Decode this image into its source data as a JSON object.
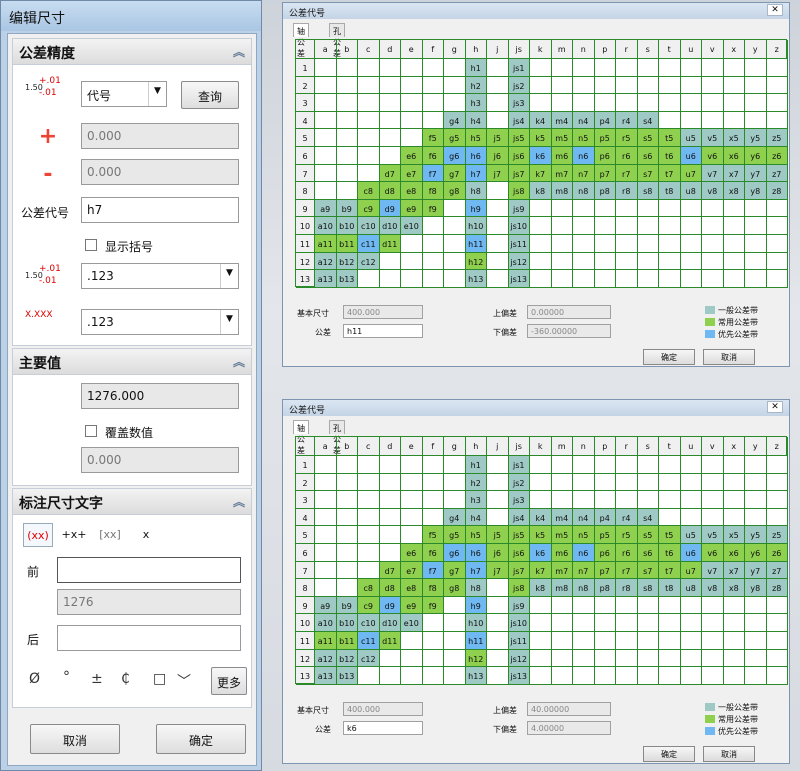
{
  "colors": {
    "general": "#9ec9c4",
    "common": "#8fd14f",
    "preferred": "#6fb8f2"
  },
  "editor": {
    "title": "编辑尺寸",
    "tolerance_precision": {
      "header": "公差精度",
      "tol_type": "代号",
      "query_button": "查询",
      "plus_value": "0.000",
      "minus_value": "0.000",
      "code_label": "公差代号",
      "code_value": "h7",
      "show_parens": "显示括号",
      "precision1": ".123",
      "precision2": ".123",
      "icon_upper": "+.01",
      "icon_lower": "-.01",
      "icon_base": "1.50"
    },
    "main_value": {
      "header": "主要值",
      "value": "1276.000",
      "override_label": "覆盖数值",
      "override_value": "0.000"
    },
    "dim_text": {
      "header": "标注尺寸文字",
      "modes": [
        "(xx)",
        "+x+",
        "[xx]",
        "x"
      ],
      "prefix_label": "前",
      "prefix_value": "",
      "mid_value": "1276",
      "suffix_label": "后",
      "suffix_value": "",
      "symbols": [
        "Ø",
        "°",
        "±",
        "₵",
        "□",
        "﹀"
      ],
      "more_button": "更多"
    },
    "cancel_button": "取消",
    "ok_button": "确定"
  },
  "tol_dialog_common": {
    "title": "公差代号",
    "tabs": [
      "轴公差",
      "孔公差"
    ],
    "columns": [
      "a",
      "b",
      "c",
      "d",
      "e",
      "f",
      "g",
      "h",
      "j",
      "js",
      "k",
      "m",
      "n",
      "p",
      "r",
      "s",
      "t",
      "u",
      "v",
      "x",
      "y",
      "z"
    ],
    "rows": [
      "1",
      "2",
      "3",
      "4",
      "5",
      "6",
      "7",
      "8",
      "9",
      "10",
      "11",
      "12",
      "13"
    ],
    "basic_size_label": "基本尺寸",
    "tol_label": "公差",
    "upper_label": "上偏差",
    "lower_label": "下偏差",
    "legend": [
      "一般公差带",
      "常用公差带",
      "优先公差带"
    ],
    "ok_button": "确定",
    "cancel_button": "取消",
    "cells": {
      "1": {
        "h": "h1",
        "js": "js1"
      },
      "2": {
        "h": "h2",
        "js": "js2"
      },
      "3": {
        "h": "h3",
        "js": "js3"
      },
      "4": {
        "g": "g4",
        "h": "h4",
        "js": "js4",
        "k": "k4",
        "m": "m4",
        "n": "n4",
        "p": "p4",
        "r": "r4",
        "s": "s4"
      },
      "5": {
        "f": "f5",
        "g": "g5",
        "h": "h5",
        "j": "j5",
        "js": "js5",
        "k": "k5",
        "m": "m5",
        "n": "n5",
        "p": "p5",
        "r": "r5",
        "s": "s5",
        "t": "t5",
        "u": "u5",
        "v": "v5",
        "x": "x5",
        "y": "y5",
        "z": "z5"
      },
      "6": {
        "e": "e6",
        "f": "f6",
        "g": "g6",
        "h": "h6",
        "j": "j6",
        "js": "js6",
        "k": "k6",
        "m": "m6",
        "n": "n6",
        "p": "p6",
        "r": "r6",
        "s": "s6",
        "t": "t6",
        "u": "u6",
        "v": "v6",
        "x": "x6",
        "y": "y6",
        "z": "z6"
      },
      "7": {
        "d": "d7",
        "e": "e7",
        "f": "f7",
        "g": "g7",
        "h": "h7",
        "j": "j7",
        "js": "js7",
        "k": "k7",
        "m": "m7",
        "n": "n7",
        "p": "p7",
        "r": "r7",
        "s": "s7",
        "t": "t7",
        "u": "u7",
        "v": "v7",
        "x": "x7",
        "y": "y7",
        "z": "z7"
      },
      "8": {
        "c": "c8",
        "d": "d8",
        "e": "e8",
        "f": "f8",
        "g": "g8",
        "h": "h8",
        "js": "js8",
        "k": "k8",
        "m": "m8",
        "n": "n8",
        "p": "p8",
        "r": "r8",
        "s": "s8",
        "t": "t8",
        "u": "u8",
        "v": "v8",
        "x": "x8",
        "y": "y8",
        "z": "z8"
      },
      "9": {
        "a": "a9",
        "b": "b9",
        "c": "c9",
        "d": "d9",
        "e": "e9",
        "f": "f9",
        "h": "h9",
        "js": "js9"
      },
      "10": {
        "a": "a10",
        "b": "b10",
        "c": "c10",
        "d": "d10",
        "e": "e10",
        "h": "h10",
        "js": "js10"
      },
      "11": {
        "a": "a11",
        "b": "b11",
        "c": "c11",
        "d": "d11",
        "h": "h11",
        "js": "js11"
      },
      "12": {
        "a": "a12",
        "b": "b12",
        "c": "c12",
        "h": "h12",
        "js": "js12"
      },
      "13": {
        "a": "a13",
        "b": "b13",
        "h": "h13",
        "js": "js13"
      }
    },
    "categories": {
      "common": [
        "f5",
        "g5",
        "h5",
        "j5",
        "js5",
        "k5",
        "m5",
        "n5",
        "p5",
        "r5",
        "s5",
        "t5",
        "e6",
        "f6",
        "j6",
        "js6",
        "m6",
        "p6",
        "r6",
        "s6",
        "t6",
        "v6",
        "x6",
        "y6",
        "z6",
        "d7",
        "e7",
        "g7",
        "j7",
        "js7",
        "k7",
        "m7",
        "n7",
        "p7",
        "r7",
        "s7",
        "t7",
        "u7",
        "c8",
        "d8",
        "e8",
        "f8",
        "g8",
        "js8",
        "c9",
        "e9",
        "f9",
        "a11",
        "b11",
        "d11",
        "h12"
      ],
      "preferred": [
        "g6",
        "h6",
        "k6",
        "n6",
        "u6",
        "f7",
        "h7",
        "d9",
        "h9",
        "c11",
        "h11"
      ]
    }
  },
  "dialog1": {
    "basic_size": "400.000",
    "tolerance": "h11",
    "upper": "0.00000",
    "lower": "-360.00000"
  },
  "dialog2": {
    "basic_size": "400.000",
    "tolerance": "k6",
    "upper": "40.00000",
    "lower": "4.00000"
  }
}
